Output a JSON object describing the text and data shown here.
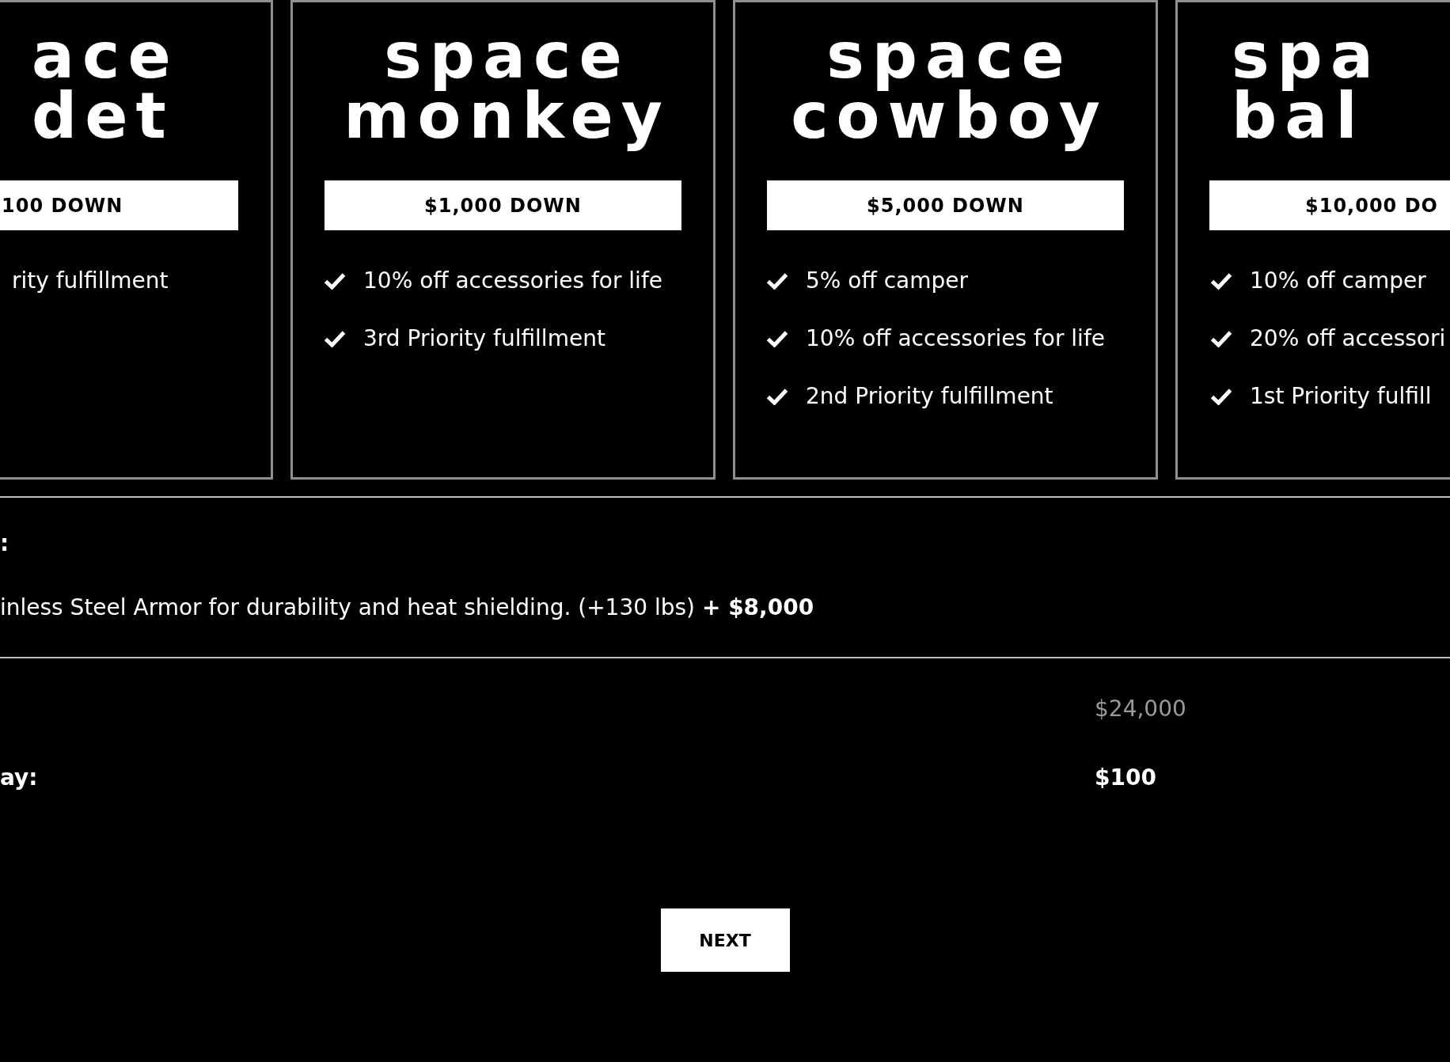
{
  "plans": [
    {
      "title": "ace det",
      "price": "100 DOWN",
      "features": [
        "rity fulfillment"
      ]
    },
    {
      "title": "space monkey",
      "price": "$1,000 DOWN",
      "features": [
        "10% off accessories for life",
        "3rd Priority fulfillment"
      ]
    },
    {
      "title": "space cowboy",
      "price": "$5,000 DOWN",
      "features": [
        "5% off camper",
        "10% off accessories for life",
        "2nd Priority fulfillment"
      ]
    },
    {
      "title": "spa bal",
      "price": "$10,000 DO",
      "features": [
        "10% off camper",
        "20% off accessori",
        "1st Priority fulfill"
      ]
    }
  ],
  "addons": {
    "label": ":",
    "description": "inless Steel Armor for durability and heat shielding. (+130 lbs) **+ $8,000**"
  },
  "totals": [
    {
      "kind": "price",
      "value": "$24,000"
    },
    {
      "kind": "due",
      "label": "ay:",
      "value": "$100"
    }
  ],
  "next_button": "NEXT"
}
